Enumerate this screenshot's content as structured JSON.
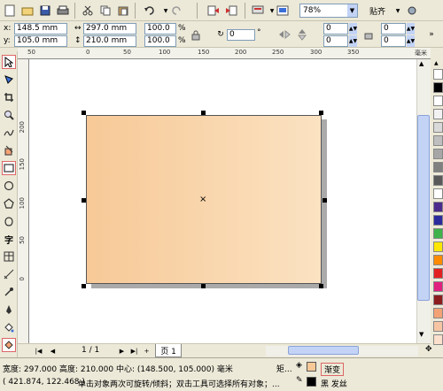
{
  "toolbar": {
    "zoom_value": "78%",
    "snap_label": "贴齐"
  },
  "property_bar": {
    "x_value": "148.5 mm",
    "y_value": "105.0 mm",
    "width_value": "297.0 mm",
    "height_value": "210.0 mm",
    "scale_x": "100.0",
    "scale_y": "100.0",
    "percent_1": "%",
    "percent_2": "%",
    "rotation_value": "0",
    "rotation_unit": "°",
    "corner_values": [
      "0",
      "0",
      "0",
      "0"
    ]
  },
  "ruler": {
    "top_labels": [
      "50",
      "0",
      "50",
      "100",
      "150",
      "200",
      "250",
      "300",
      "350"
    ],
    "top_unit": "毫米",
    "left_labels": [
      "200",
      "150",
      "100",
      "50",
      "0"
    ]
  },
  "navigator": {
    "page_counter": "1 / 1",
    "page_tab_label": "页 1"
  },
  "status": {
    "dimensions": "宽度: 297.000  高度: 210.000  中心: (148.500, 105.000)  毫米",
    "object_type": "矩...",
    "hint": "单击对象两次可旋转/倾斜；双击工具可选择所有对象；...",
    "cursor_pos": "( 421.874, 122.468 )",
    "fill_label": "渐变",
    "outline_label": "黑  发丝"
  },
  "colors": {
    "gradient_start": "#f7c997",
    "gradient_end": "#fbe2c2",
    "palette": [
      "#ffffff",
      "#000000",
      "#ffffff",
      "#f2f2f2",
      "#d9d9d9",
      "#bfbfbf",
      "#a6a6a6",
      "#808080",
      "#595959",
      "#ffffff",
      "#4b2c8c",
      "#2b2b9c",
      "#3fb24a",
      "#ffe600",
      "#ff8c00",
      "#e32020",
      "#e0207e",
      "#8c1d1d",
      "#f3a276",
      "#f7c5a4",
      "#fbe0cd"
    ]
  },
  "tools": [
    "pick-tool",
    "shape-tool",
    "crop-tool",
    "zoom-tool",
    "freehand-tool",
    "smart-fill-tool",
    "rectangle-tool",
    "ellipse-tool",
    "polygon-tool",
    "basic-shapes-tool",
    "text-tool",
    "table-tool",
    "dimension-tool",
    "eyedropper-tool",
    "outline-tool",
    "fill-tool"
  ]
}
